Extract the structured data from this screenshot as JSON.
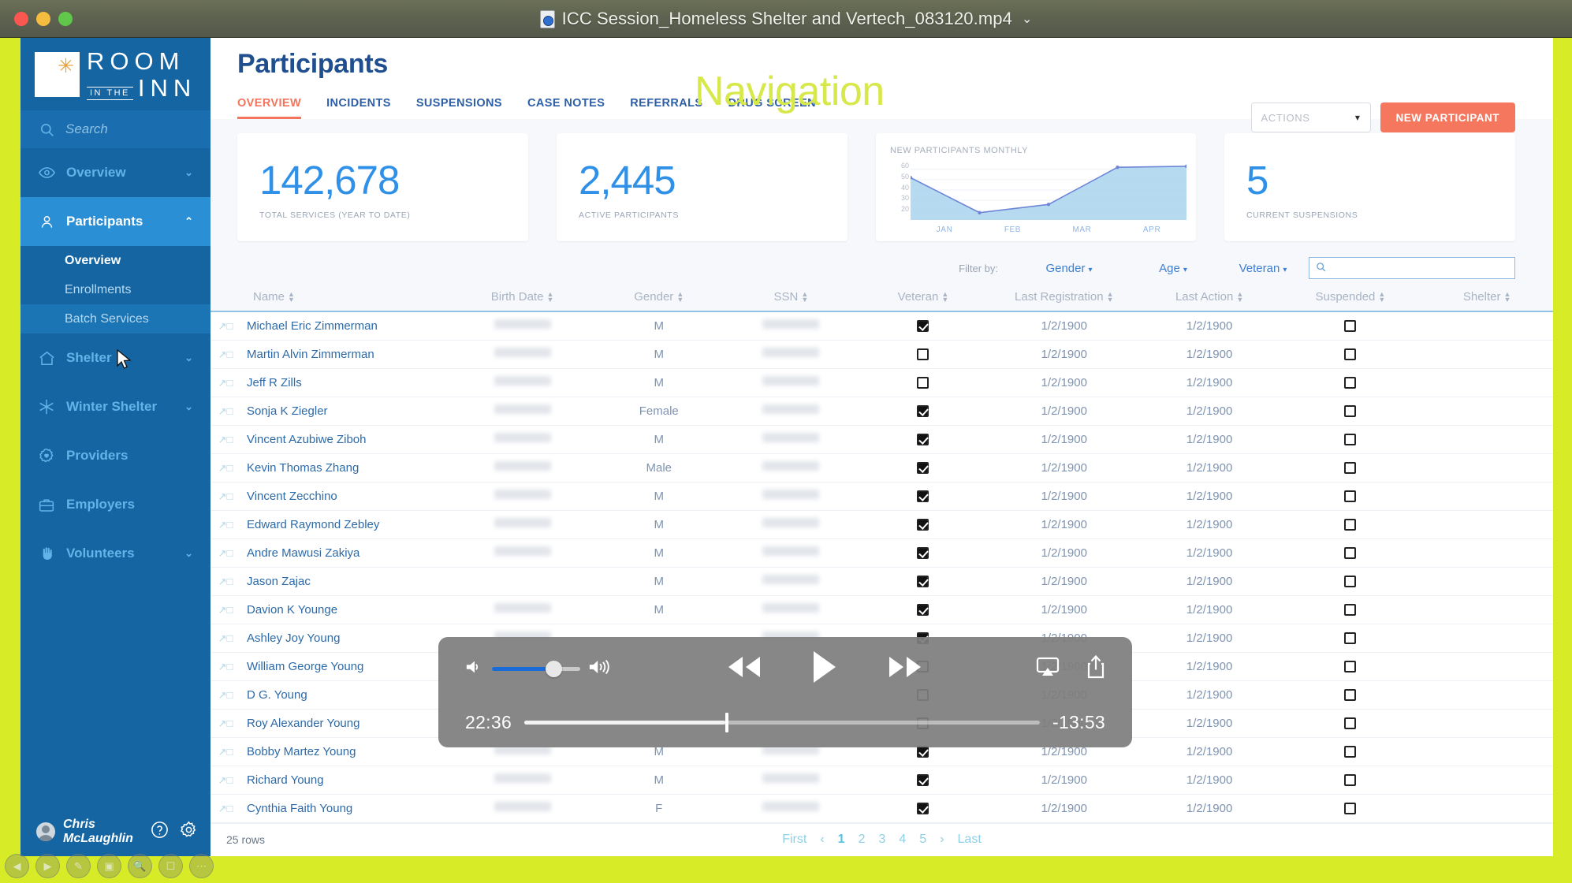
{
  "window": {
    "title": "ICC Session_Homeless Shelter and Vertech_083120.mp4",
    "title_caret": "⌄",
    "file_icon": "quicktime-file-icon"
  },
  "annotation": {
    "navigation_label": "Navigation",
    "frame_color": "#d7ec26"
  },
  "sidebar": {
    "logo": {
      "line1": "ROOM",
      "small": "IN THE",
      "line2": "INN",
      "star": "✳"
    },
    "search_placeholder": "Search",
    "items": [
      {
        "label": "Overview",
        "icon": "eye-icon",
        "chevron": "⌄",
        "active": false
      },
      {
        "label": "Participants",
        "icon": "person-icon",
        "chevron": "⌃",
        "active": true
      },
      {
        "label": "Shelter",
        "icon": "home-icon",
        "chevron": "⌄",
        "active": false
      },
      {
        "label": "Winter Shelter",
        "icon": "snowflake-icon",
        "chevron": "⌄",
        "active": false
      },
      {
        "label": "Providers",
        "icon": "gear-heart-icon",
        "chevron": "",
        "active": false
      },
      {
        "label": "Employers",
        "icon": "briefcase-icon",
        "chevron": "",
        "active": false
      },
      {
        "label": "Volunteers",
        "icon": "hand-icon",
        "chevron": "⌄",
        "active": false
      }
    ],
    "sub_items": [
      {
        "label": "Overview",
        "current": true
      },
      {
        "label": "Enrollments",
        "current": false
      },
      {
        "label": "Batch Services",
        "current": false
      }
    ],
    "user": "Chris McLaughlin",
    "help_icon": "question-circle-icon",
    "settings_icon": "gear-icon"
  },
  "header": {
    "page_title": "Participants",
    "tabs": [
      {
        "label": "OVERVIEW",
        "active": true
      },
      {
        "label": "INCIDENTS",
        "active": false
      },
      {
        "label": "SUSPENSIONS",
        "active": false
      },
      {
        "label": "CASE NOTES",
        "active": false
      },
      {
        "label": "REFERRALS",
        "active": false
      },
      {
        "label": "DRUG SCREEN",
        "active": false
      }
    ],
    "actions_select": "ACTIONS",
    "new_participant_button": "NEW PARTICIPANT",
    "accent_color": "#f4775e"
  },
  "cards": [
    {
      "value": "142,678",
      "label": "TOTAL SERVICES (YEAR TO DATE)"
    },
    {
      "value": "2,445",
      "label": "ACTIVE PARTICIPANTS"
    },
    {
      "value": "5",
      "label": "CURRENT SUSPENSIONS"
    }
  ],
  "chart_data": {
    "type": "area",
    "title": "NEW PARTICIPANTS MONTHLY",
    "categories": [
      "JAN",
      "FEB",
      "MAR",
      "APR"
    ],
    "x": [
      0,
      1,
      2,
      3,
      4,
      5
    ],
    "values": [
      52,
      18,
      26,
      62,
      63
    ],
    "yticks": [
      "60",
      "50",
      "40",
      "30",
      "20"
    ],
    "ylim": [
      14,
      66
    ],
    "xlabel": "",
    "ylabel": "",
    "grid": true,
    "legend": "none",
    "line_color": "#6e86d8",
    "fill_color": "#a9d3ec"
  },
  "filters": {
    "label": "Filter by:",
    "dropdowns": [
      {
        "label": "Gender",
        "caret": "▾"
      },
      {
        "label": "Age",
        "caret": "▾"
      },
      {
        "label": "Veteran",
        "caret": "▾"
      }
    ],
    "search_value": "",
    "search_icon": "search-icon"
  },
  "table": {
    "columns": [
      {
        "label": "Name",
        "align": "left"
      },
      {
        "label": "Birth Date",
        "align": "center"
      },
      {
        "label": "Gender",
        "align": "center"
      },
      {
        "label": "SSN",
        "align": "center"
      },
      {
        "label": "Veteran",
        "align": "center"
      },
      {
        "label": "Last Registration",
        "align": "center"
      },
      {
        "label": "Last Action",
        "align": "center"
      },
      {
        "label": "Suspended",
        "align": "center"
      },
      {
        "label": "Shelter",
        "align": "center"
      }
    ],
    "rows": [
      {
        "name": "Michael Eric Zimmerman",
        "birth": "redacted",
        "gender": "M",
        "ssn": "redacted",
        "veteran": true,
        "last_registration": "1/2/1900",
        "last_action": "1/2/1900",
        "suspended": false,
        "shelter": ""
      },
      {
        "name": "Martin Alvin Zimmerman",
        "birth": "redacted",
        "gender": "M",
        "ssn": "redacted",
        "veteran": false,
        "last_registration": "1/2/1900",
        "last_action": "1/2/1900",
        "suspended": false,
        "shelter": ""
      },
      {
        "name": "Jeff R Zills",
        "birth": "redacted",
        "gender": "M",
        "ssn": "redacted",
        "veteran": false,
        "last_registration": "1/2/1900",
        "last_action": "1/2/1900",
        "suspended": false,
        "shelter": ""
      },
      {
        "name": "Sonja K Ziegler",
        "birth": "redacted",
        "gender": "Female",
        "ssn": "redacted",
        "veteran": true,
        "last_registration": "1/2/1900",
        "last_action": "1/2/1900",
        "suspended": false,
        "shelter": ""
      },
      {
        "name": "Vincent Azubiwe Ziboh",
        "birth": "redacted",
        "gender": "M",
        "ssn": "redacted",
        "veteran": true,
        "last_registration": "1/2/1900",
        "last_action": "1/2/1900",
        "suspended": false,
        "shelter": ""
      },
      {
        "name": "Kevin Thomas Zhang",
        "birth": "redacted",
        "gender": "Male",
        "ssn": "redacted",
        "veteran": true,
        "last_registration": "1/2/1900",
        "last_action": "1/2/1900",
        "suspended": false,
        "shelter": ""
      },
      {
        "name": "Vincent Zecchino",
        "birth": "redacted",
        "gender": "M",
        "ssn": "redacted",
        "veteran": true,
        "last_registration": "1/2/1900",
        "last_action": "1/2/1900",
        "suspended": false,
        "shelter": ""
      },
      {
        "name": "Edward Raymond Zebley",
        "birth": "redacted",
        "gender": "M",
        "ssn": "redacted",
        "veteran": true,
        "last_registration": "1/2/1900",
        "last_action": "1/2/1900",
        "suspended": false,
        "shelter": ""
      },
      {
        "name": "Andre Mawusi Zakiya",
        "birth": "redacted",
        "gender": "M",
        "ssn": "redacted",
        "veteran": true,
        "last_registration": "1/2/1900",
        "last_action": "1/2/1900",
        "suspended": false,
        "shelter": ""
      },
      {
        "name": "Jason Zajac",
        "birth": "",
        "gender": "M",
        "ssn": "redacted",
        "veteran": true,
        "last_registration": "1/2/1900",
        "last_action": "1/2/1900",
        "suspended": false,
        "shelter": ""
      },
      {
        "name": "Davion K Younge",
        "birth": "redacted",
        "gender": "M",
        "ssn": "redacted",
        "veteran": true,
        "last_registration": "1/2/1900",
        "last_action": "1/2/1900",
        "suspended": false,
        "shelter": ""
      },
      {
        "name": "Ashley Joy Young",
        "birth": "redacted",
        "gender": "",
        "ssn": "redacted",
        "veteran": true,
        "last_registration": "1/2/1900",
        "last_action": "1/2/1900",
        "suspended": false,
        "shelter": ""
      },
      {
        "name": "William George Young",
        "birth": "",
        "gender": "",
        "ssn": "",
        "veteran": false,
        "last_registration": "1/2/1900",
        "last_action": "1/2/1900",
        "suspended": false,
        "shelter": ""
      },
      {
        "name": "D G. Young",
        "birth": "",
        "gender": "",
        "ssn": "",
        "veteran": false,
        "last_registration": "1/2/1900",
        "last_action": "1/2/1900",
        "suspended": false,
        "shelter": ""
      },
      {
        "name": "Roy Alexander Young",
        "birth": "",
        "gender": "",
        "ssn": "",
        "veteran": false,
        "last_registration": "1/2/1900",
        "last_action": "1/2/1900",
        "suspended": false,
        "shelter": ""
      },
      {
        "name": "Bobby Martez Young",
        "birth": "redacted",
        "gender": "M",
        "ssn": "redacted",
        "veteran": true,
        "last_registration": "1/2/1900",
        "last_action": "1/2/1900",
        "suspended": false,
        "shelter": ""
      },
      {
        "name": "Richard Young",
        "birth": "redacted",
        "gender": "M",
        "ssn": "redacted",
        "veteran": true,
        "last_registration": "1/2/1900",
        "last_action": "1/2/1900",
        "suspended": false,
        "shelter": ""
      },
      {
        "name": "Cynthia Faith Young",
        "birth": "redacted",
        "gender": "F",
        "ssn": "redacted",
        "veteran": true,
        "last_registration": "1/2/1900",
        "last_action": "1/2/1900",
        "suspended": false,
        "shelter": ""
      }
    ],
    "rows_count": "25 rows",
    "pagination": {
      "first": "First",
      "prev": "‹",
      "pages": [
        "1",
        "2",
        "3",
        "4",
        "5"
      ],
      "current_page": "1",
      "next": "›",
      "last": "Last"
    }
  },
  "video_controls": {
    "elapsed": "22:36",
    "remaining": "-13:53",
    "progress_percent": 39,
    "volume_percent": 66,
    "buttons": [
      {
        "name": "rewind-button"
      },
      {
        "name": "play-button"
      },
      {
        "name": "fast-forward-button"
      },
      {
        "name": "airplay-button"
      },
      {
        "name": "share-button"
      }
    ]
  },
  "presenter_toolbar": [
    "previous-slide-button",
    "next-slide-button",
    "pen-button",
    "slide-grid-button",
    "zoom-button",
    "captions-button",
    "more-options-button"
  ]
}
